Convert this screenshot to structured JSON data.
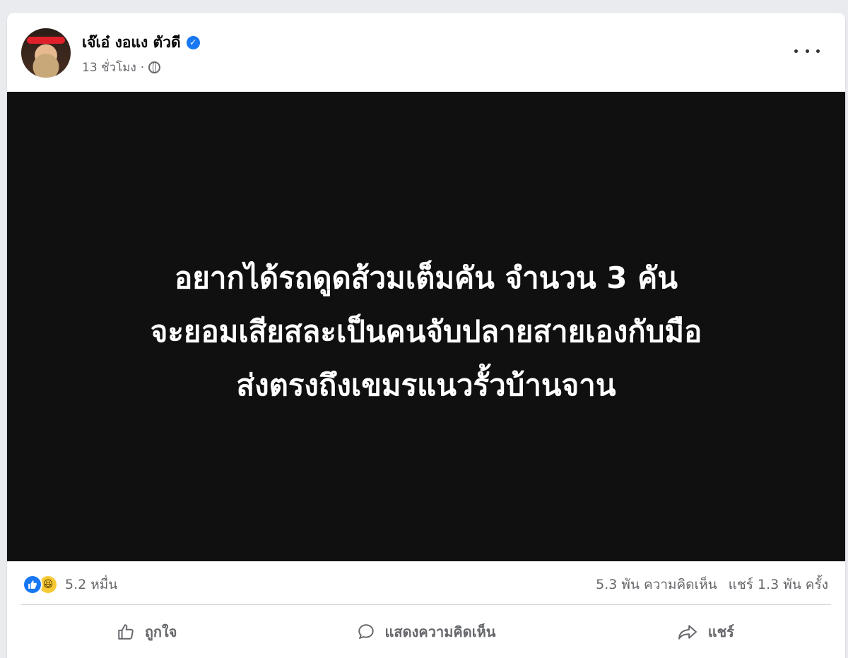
{
  "post": {
    "author": "เจ๊เอ๋ งอแง ตัวดี",
    "time": "13 ชั่วโมง",
    "privacy_icon": "globe-icon",
    "verified_icon": "verified-badge-icon",
    "more_icon": "more-options-icon"
  },
  "media": {
    "background": "#101010",
    "lines": [
      "อยากได้รถดูดส้วมเต็มคัน จำนวน 3 คัน",
      "จะยอมเสียสละเป็นคนจับปลายสายเองกับมือ",
      "ส่งตรงถึงเขมรแนวรั้วบ้านจาน"
    ]
  },
  "stats": {
    "reactions": "5.2 หมื่น",
    "comments": "5.3 พัน ความคิดเห็น",
    "shares": "แชร์ 1.3 พัน ครั้ง"
  },
  "actions": {
    "like": "ถูกใจ",
    "comment": "แสดงความคิดเห็น",
    "share": "แชร์"
  },
  "colors": {
    "accent": "#1877f2",
    "secondary_text": "#65676b"
  }
}
